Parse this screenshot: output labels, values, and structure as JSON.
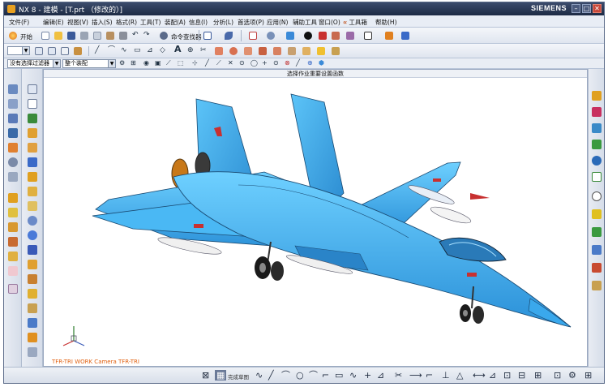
{
  "window": {
    "title": "NX 8 - 建模 - [T.prt （修改的）]",
    "brand": "SIEMENS",
    "controls": [
      "–",
      "□",
      "✕"
    ]
  },
  "menu": {
    "items": [
      "文件(F)",
      "编辑(E)",
      "视图(V)",
      "插入(S)",
      "格式(R)",
      "工具(T)",
      "装配(A)",
      "信息(I)",
      "分析(L)",
      "首选项(P)",
      "应用(N)",
      "辅助工具",
      "窗口(O)",
      "工具箱",
      "帮助(H)"
    ]
  },
  "toolbar": {
    "start_label": "开始",
    "command_finder_label": "命令查找器"
  },
  "selection_bar": {
    "filter_value": "没有选择过滤器",
    "scope_value": "整个装配"
  },
  "viewport": {
    "cue_text": "选择作业重要设置函数",
    "view_label": "TFR-TRI WORK Camera TFR-TRI"
  },
  "sketch_toolbar": {
    "label": "完成草图"
  },
  "colors": {
    "titlebar": "#1c2a44",
    "aircraft_body": "#3fb0f2",
    "aircraft_edge": "#1a4a72",
    "roundel": "#c83030",
    "exhaust": "#c87818",
    "view_label": "#e06010"
  }
}
